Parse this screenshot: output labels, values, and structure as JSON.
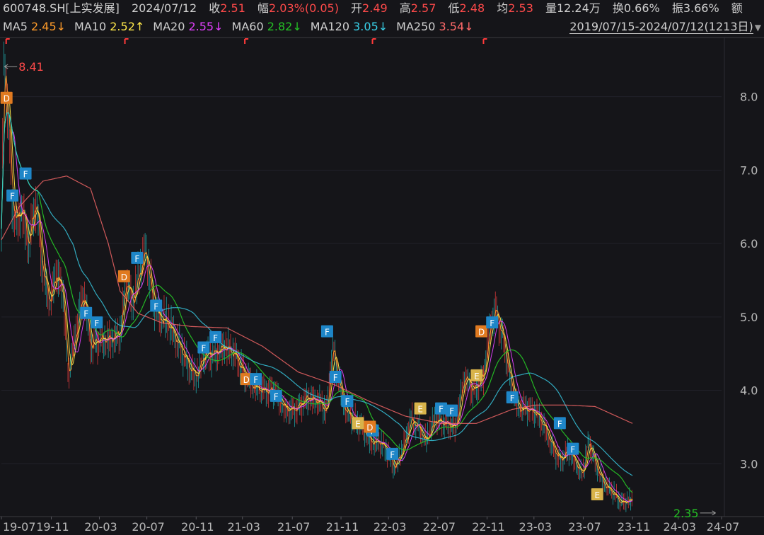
{
  "header": {
    "code": "600748.SH[上实发展]",
    "date": "2024/07/12",
    "close_label": "收",
    "close": "2.51",
    "chg_label": "幅",
    "chg": "2.03%(0.05)",
    "open_label": "开",
    "open": "2.49",
    "high_label": "高",
    "high": "2.57",
    "low_label": "低",
    "low": "2.48",
    "avg_label": "均",
    "avg": "2.53",
    "vol_label": "量",
    "vol": "12.24万",
    "turn_label": "换",
    "turn": "0.66%",
    "amp_label": "振",
    "amp": "3.66%",
    "amt_label": "额"
  },
  "ma_legend": [
    {
      "name": "MA5",
      "value": "2.45↓",
      "color": "#ff9c2a"
    },
    {
      "name": "MA10",
      "value": "2.52↑",
      "color": "#ffe84a"
    },
    {
      "name": "MA20",
      "value": "2.55↓",
      "color": "#e040fb"
    },
    {
      "name": "MA60",
      "value": "2.82↓",
      "color": "#25c025"
    },
    {
      "name": "MA120",
      "value": "3.05↓",
      "color": "#38d0e8"
    },
    {
      "name": "MA250",
      "value": "3.54↓",
      "color": "#ff6a6a"
    }
  ],
  "range": {
    "text": "2019/07/15-2024/07/12(1213日)",
    "arrow": "▼"
  },
  "chart_data": {
    "type": "line",
    "ylim": [
      2.3,
      8.7
    ],
    "y_ticks": [
      "8.0",
      "7.0",
      "6.0",
      "5.0",
      "4.0",
      "3.0"
    ],
    "y_tick_values": [
      8,
      7,
      6,
      5,
      4,
      3
    ],
    "x_labels": [
      "19-07",
      "19-11",
      "20-03",
      "20-07",
      "20-11",
      "21-03",
      "21-07",
      "21-11",
      "22-03",
      "22-07",
      "22-11",
      "23-03",
      "23-07",
      "23-11",
      "24-03",
      "24-07"
    ],
    "x_label_idx": [
      0,
      84,
      165,
      245,
      328,
      406,
      490,
      572,
      652,
      735,
      818,
      897,
      980,
      1063,
      1140,
      1213
    ],
    "n_days": 1213,
    "max_label": "8.41",
    "max_value": 8.41,
    "max_idx": 5,
    "min_label": "2.35",
    "min_value": 2.35,
    "min_idx": 1203,
    "close_anchors": [
      [
        0,
        6.2
      ],
      [
        4,
        8.41
      ],
      [
        10,
        8.0
      ],
      [
        18,
        6.6
      ],
      [
        25,
        6.3
      ],
      [
        35,
        6.5
      ],
      [
        45,
        6.0
      ],
      [
        58,
        6.6
      ],
      [
        70,
        5.6
      ],
      [
        82,
        5.2
      ],
      [
        92,
        5.6
      ],
      [
        104,
        5.3
      ],
      [
        112,
        4.2
      ],
      [
        122,
        4.6
      ],
      [
        132,
        5.1
      ],
      [
        140,
        5.3
      ],
      [
        150,
        4.6
      ],
      [
        165,
        4.7
      ],
      [
        185,
        4.7
      ],
      [
        200,
        4.8
      ],
      [
        210,
        5.5
      ],
      [
        222,
        5.2
      ],
      [
        232,
        5.6
      ],
      [
        243,
        5.9
      ],
      [
        255,
        5.2
      ],
      [
        265,
        5.0
      ],
      [
        282,
        4.9
      ],
      [
        300,
        4.6
      ],
      [
        318,
        4.3
      ],
      [
        328,
        4.2
      ],
      [
        342,
        4.5
      ],
      [
        358,
        4.5
      ],
      [
        375,
        4.6
      ],
      [
        392,
        4.5
      ],
      [
        410,
        4.2
      ],
      [
        425,
        4.05
      ],
      [
        442,
        4.0
      ],
      [
        460,
        4.0
      ],
      [
        478,
        3.75
      ],
      [
        495,
        3.75
      ],
      [
        515,
        3.9
      ],
      [
        535,
        3.85
      ],
      [
        548,
        3.7
      ],
      [
        558,
        4.6
      ],
      [
        566,
        4.2
      ],
      [
        578,
        3.75
      ],
      [
        592,
        3.6
      ],
      [
        608,
        3.5
      ],
      [
        622,
        3.3
      ],
      [
        638,
        3.3
      ],
      [
        652,
        3.15
      ],
      [
        662,
        2.95
      ],
      [
        676,
        3.2
      ],
      [
        690,
        3.6
      ],
      [
        702,
        3.5
      ],
      [
        715,
        3.3
      ],
      [
        730,
        3.6
      ],
      [
        748,
        3.55
      ],
      [
        765,
        3.5
      ],
      [
        780,
        4.2
      ],
      [
        795,
        4.0
      ],
      [
        812,
        4.2
      ],
      [
        822,
        4.8
      ],
      [
        832,
        5.1
      ],
      [
        845,
        4.7
      ],
      [
        858,
        4.1
      ],
      [
        870,
        3.75
      ],
      [
        885,
        3.75
      ],
      [
        900,
        3.7
      ],
      [
        915,
        3.5
      ],
      [
        930,
        3.2
      ],
      [
        942,
        3.05
      ],
      [
        955,
        3.2
      ],
      [
        968,
        3.0
      ],
      [
        978,
        2.85
      ],
      [
        990,
        3.3
      ],
      [
        1000,
        3.0
      ],
      [
        1015,
        2.72
      ],
      [
        1030,
        2.6
      ],
      [
        1043,
        2.47
      ],
      [
        1063,
        2.51
      ]
    ],
    "series": [
      {
        "name": "MA5",
        "color": "#ff9c2a",
        "window": 5
      },
      {
        "name": "MA10",
        "color": "#ffe84a",
        "window": 10
      },
      {
        "name": "MA20",
        "color": "#e040fb",
        "window": 20
      },
      {
        "name": "MA60",
        "color": "#25c025",
        "window": 60
      },
      {
        "name": "MA120",
        "color": "#38d0e8",
        "window": 120
      },
      {
        "name": "MA250",
        "color": "#ff6a6a",
        "window": 250,
        "anchors": [
          [
            0,
            6.05
          ],
          [
            30,
            6.5
          ],
          [
            70,
            6.85
          ],
          [
            110,
            6.92
          ],
          [
            150,
            6.75
          ],
          [
            180,
            6.0
          ],
          [
            200,
            5.35
          ],
          [
            230,
            5.05
          ],
          [
            270,
            4.92
          ],
          [
            320,
            4.87
          ],
          [
            380,
            4.85
          ],
          [
            440,
            4.6
          ],
          [
            500,
            4.25
          ],
          [
            560,
            4.08
          ],
          [
            620,
            3.85
          ],
          [
            680,
            3.65
          ],
          [
            740,
            3.55
          ],
          [
            800,
            3.55
          ],
          [
            860,
            3.74
          ],
          [
            900,
            3.8
          ],
          [
            950,
            3.8
          ],
          [
            1000,
            3.78
          ],
          [
            1063,
            3.55
          ]
        ]
      }
    ],
    "markers": [
      {
        "t": "D",
        "i": 8,
        "y": 7.98
      },
      {
        "t": "F",
        "i": 40,
        "y": 6.95
      },
      {
        "t": "F",
        "i": 18,
        "y": 6.65
      },
      {
        "t": "F",
        "i": 142,
        "y": 5.05
      },
      {
        "t": "F",
        "i": 160,
        "y": 4.92
      },
      {
        "t": "D",
        "i": 206,
        "y": 5.55
      },
      {
        "t": "F",
        "i": 228,
        "y": 5.8
      },
      {
        "t": "F",
        "i": 260,
        "y": 5.15
      },
      {
        "t": "F",
        "i": 340,
        "y": 4.58
      },
      {
        "t": "F",
        "i": 360,
        "y": 4.72
      },
      {
        "t": "D",
        "i": 412,
        "y": 4.15
      },
      {
        "t": "F",
        "i": 428,
        "y": 4.15
      },
      {
        "t": "F",
        "i": 462,
        "y": 3.92
      },
      {
        "t": "F",
        "i": 548,
        "y": 4.8
      },
      {
        "t": "F",
        "i": 562,
        "y": 4.18
      },
      {
        "t": "F",
        "i": 582,
        "y": 3.85
      },
      {
        "t": "E",
        "i": 600,
        "y": 3.55
      },
      {
        "t": "F",
        "i": 625,
        "y": 3.45
      },
      {
        "t": "D",
        "i": 620,
        "y": 3.5
      },
      {
        "t": "F",
        "i": 658,
        "y": 3.13
      },
      {
        "t": "E",
        "i": 705,
        "y": 3.75
      },
      {
        "t": "F",
        "i": 740,
        "y": 3.75
      },
      {
        "t": "F",
        "i": 758,
        "y": 3.72
      },
      {
        "t": "E",
        "i": 800,
        "y": 4.2
      },
      {
        "t": "D",
        "i": 808,
        "y": 4.8
      },
      {
        "t": "F",
        "i": 826,
        "y": 4.92
      },
      {
        "t": "F",
        "i": 860,
        "y": 3.9
      },
      {
        "t": "F",
        "i": 940,
        "y": 3.55
      },
      {
        "t": "F",
        "i": 962,
        "y": 3.2
      },
      {
        "t": "E",
        "i": 1003,
        "y": 2.58
      }
    ],
    "marker_colors": {
      "D": "#e07a20",
      "F": "#1e86c8",
      "E": "#d8b34a"
    },
    "top_ticks_idx": [
      8,
      208,
      410,
      625,
      812
    ],
    "grid": true
  }
}
